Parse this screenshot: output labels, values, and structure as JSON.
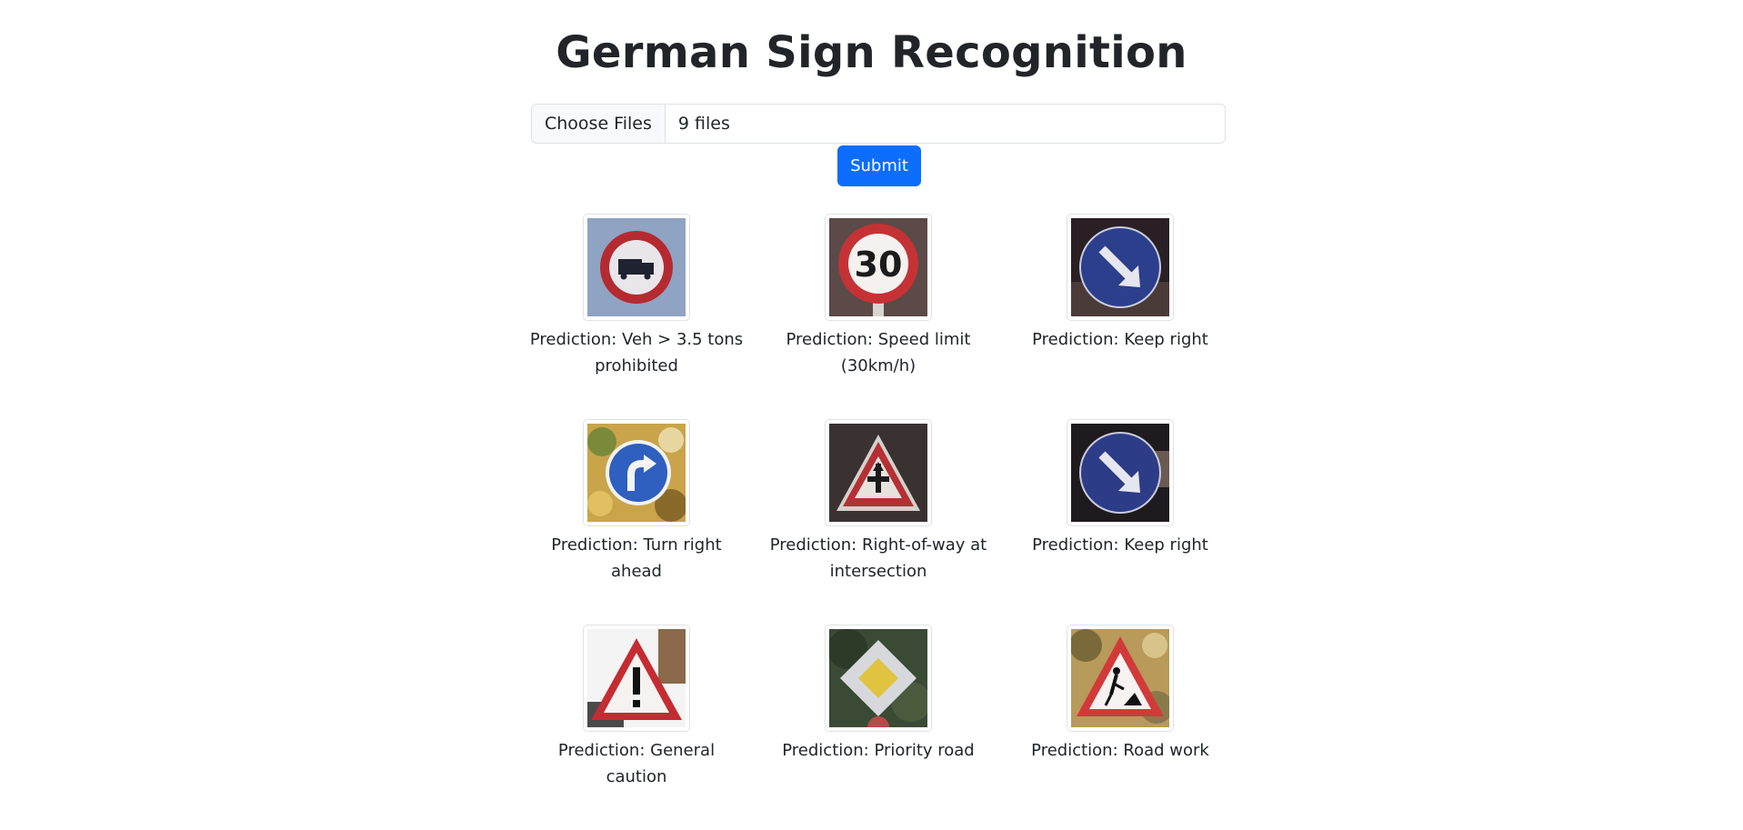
{
  "page": {
    "title": "German Sign Recognition"
  },
  "upload": {
    "choose_label": "Choose Files",
    "file_status": "9 files",
    "submit_label": "Submit"
  },
  "results": [
    {
      "icon": "truck-prohibited-sign-icon",
      "caption": "Prediction: Veh > 3.5 tons prohibited"
    },
    {
      "icon": "speed-limit-30-sign-icon",
      "caption": "Prediction: Speed limit (30km/h)"
    },
    {
      "icon": "keep-right-sign-icon",
      "caption": "Prediction: Keep right"
    },
    {
      "icon": "turn-right-ahead-sign-icon",
      "caption": "Prediction: Turn right ahead"
    },
    {
      "icon": "right-of-way-sign-icon",
      "caption": "Prediction: Right-of-way at intersection"
    },
    {
      "icon": "keep-right-sign-icon",
      "caption": "Prediction: Keep right"
    },
    {
      "icon": "general-caution-sign-icon",
      "caption": "Prediction: General caution"
    },
    {
      "icon": "priority-road-sign-icon",
      "caption": "Prediction: Priority road"
    },
    {
      "icon": "road-work-sign-icon",
      "caption": "Prediction: Road work"
    }
  ],
  "colors": {
    "primary": "#0d6efd",
    "text": "#212529",
    "border": "#dee2e6"
  }
}
